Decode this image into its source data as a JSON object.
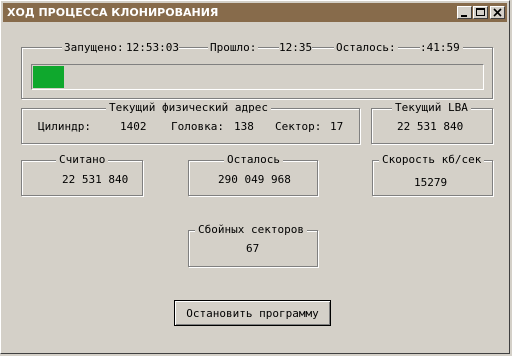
{
  "window": {
    "title": "ХОД ПРОЦЕССА КЛОНИРОВАНИЯ"
  },
  "titlebar_buttons": [
    {
      "name": "minimize",
      "icon": "minimize-icon"
    },
    {
      "name": "maximize",
      "icon": "maximize-icon"
    },
    {
      "name": "close",
      "icon": "close-icon"
    }
  ],
  "progress": {
    "started_label": "Запущено:",
    "started_value": "12:53:03",
    "elapsed_label": "Прошло:",
    "elapsed_value": "12:35",
    "remaining_label": "Осталось:",
    "remaining_value": ":41:59",
    "fraction": 0.07,
    "fill_color": "#0fa82d"
  },
  "physical_address": {
    "legend": "Текущий физический адрес",
    "cylinder_label": "Цилиндр:",
    "cylinder_value": "1402",
    "head_label": "Головка:",
    "head_value": "138",
    "sector_label": "Сектор:",
    "sector_value": "17"
  },
  "lba": {
    "legend": "Текущий LBA",
    "value": "22 531 840"
  },
  "read": {
    "legend": "Считано",
    "value": "22 531 840"
  },
  "remaining": {
    "legend": "Осталось",
    "value": "290 049 968"
  },
  "speed": {
    "legend": "Скорость кб/сек",
    "value": "15279"
  },
  "bad_sectors": {
    "legend": "Сбойных секторов",
    "value": "67"
  },
  "actions": {
    "stop_label": "Остановить программу"
  },
  "colors": {
    "titlebar": "#876b4b",
    "face": "#d4d0c8"
  }
}
